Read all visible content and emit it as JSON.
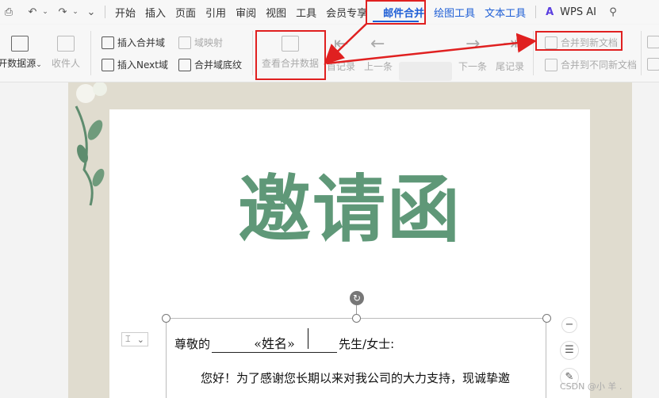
{
  "menubar": {
    "items": [
      {
        "label": "开始"
      },
      {
        "label": "插入"
      },
      {
        "label": "页面"
      },
      {
        "label": "引用"
      },
      {
        "label": "审阅"
      },
      {
        "label": "视图"
      },
      {
        "label": "工具"
      },
      {
        "label": "会员专享"
      },
      {
        "label": "邮件合并"
      },
      {
        "label": "绘图工具"
      },
      {
        "label": "文本工具"
      }
    ],
    "wps_ai": "WPS AI"
  },
  "ribbon": {
    "open_source": "开数据源",
    "recipients": "收件人",
    "insert_merge_field": "插入合并域",
    "field_mapping": "域映射",
    "insert_next": "插入Next域",
    "merge_shading": "合并域底纹",
    "view_merged_data": "查看合并数据",
    "first_record": "首记录",
    "prev_record": "上一条",
    "next_record": "下一条",
    "last_record": "尾记录",
    "merge_to_new": "合并到新文档",
    "merge_to_diff_new": "合并到不同新文档"
  },
  "document": {
    "title": "邀请函",
    "salutation_prefix": "尊敬的",
    "merge_field": "«姓名»",
    "salutation_suffix": "先生/女士:",
    "body_line": "您好！为了感谢您长期以来对我公司的大力支持，现诚挚邀"
  },
  "watermark": "CSDN @小 羊 ."
}
